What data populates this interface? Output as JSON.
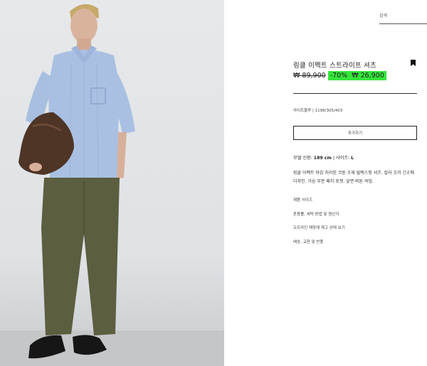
{
  "header": {
    "search_label": "검색"
  },
  "product": {
    "name": "링클 이펙트 스트라이프 셔츠",
    "old_price": "₩ 89,900",
    "discount": "-70%",
    "new_price": "₩ 26,900",
    "color_ref": "라이트블루 | 1198/305/403",
    "add_button": "추가하기",
    "model_info_prefix": "모델 신장: ",
    "model_height": "189 cm",
    "model_size_prefix": " | 사이즈: ",
    "model_size": "L",
    "description": "링클 이펙트 마감 처리된 코튼 소재 릴렉스핏 셔츠. 칼라 깃과 긴소매 디자인. 가슴 부분 패치 포켓. 앞면 버튼 여밈."
  },
  "links": [
    "제품 사이즈",
    "혼용률, 세탁 방법 및 원산지",
    "오프라인 매장에 재고 상태 보기",
    "배송, 교환 및 반품"
  ],
  "colors": {
    "discount_bg": "#34e63a",
    "shirt": "#a9c0e2",
    "trousers": "#5b5e3f"
  },
  "icons": {
    "bookmark": "bookmark-icon"
  }
}
